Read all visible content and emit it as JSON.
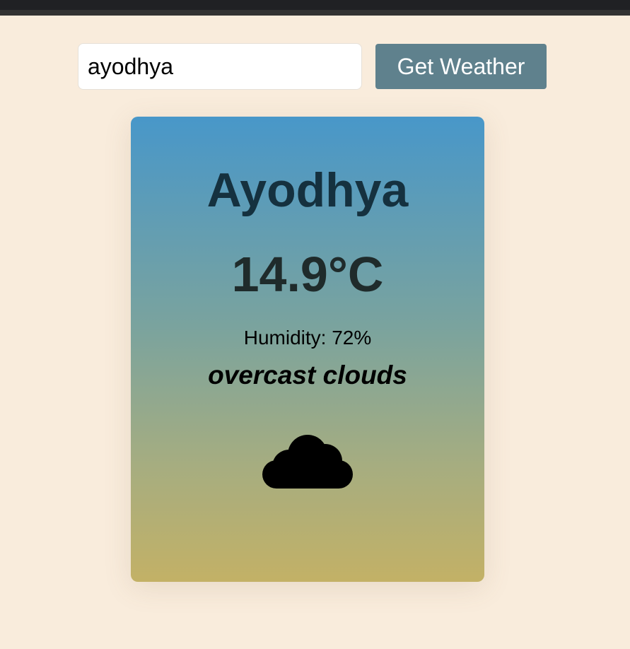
{
  "search": {
    "value": "ayodhya",
    "button_label": "Get Weather"
  },
  "weather": {
    "city": "Ayodhya",
    "temperature": "14.9°C",
    "humidity": "Humidity: 72%",
    "description": "overcast clouds",
    "icon": "cloud-icon"
  },
  "colors": {
    "page_background": "#f9ecdc",
    "button_background": "#5f818d",
    "card_gradient_top": "#4897c9",
    "card_gradient_bottom": "#c3b166",
    "city_text": "#15313f"
  }
}
